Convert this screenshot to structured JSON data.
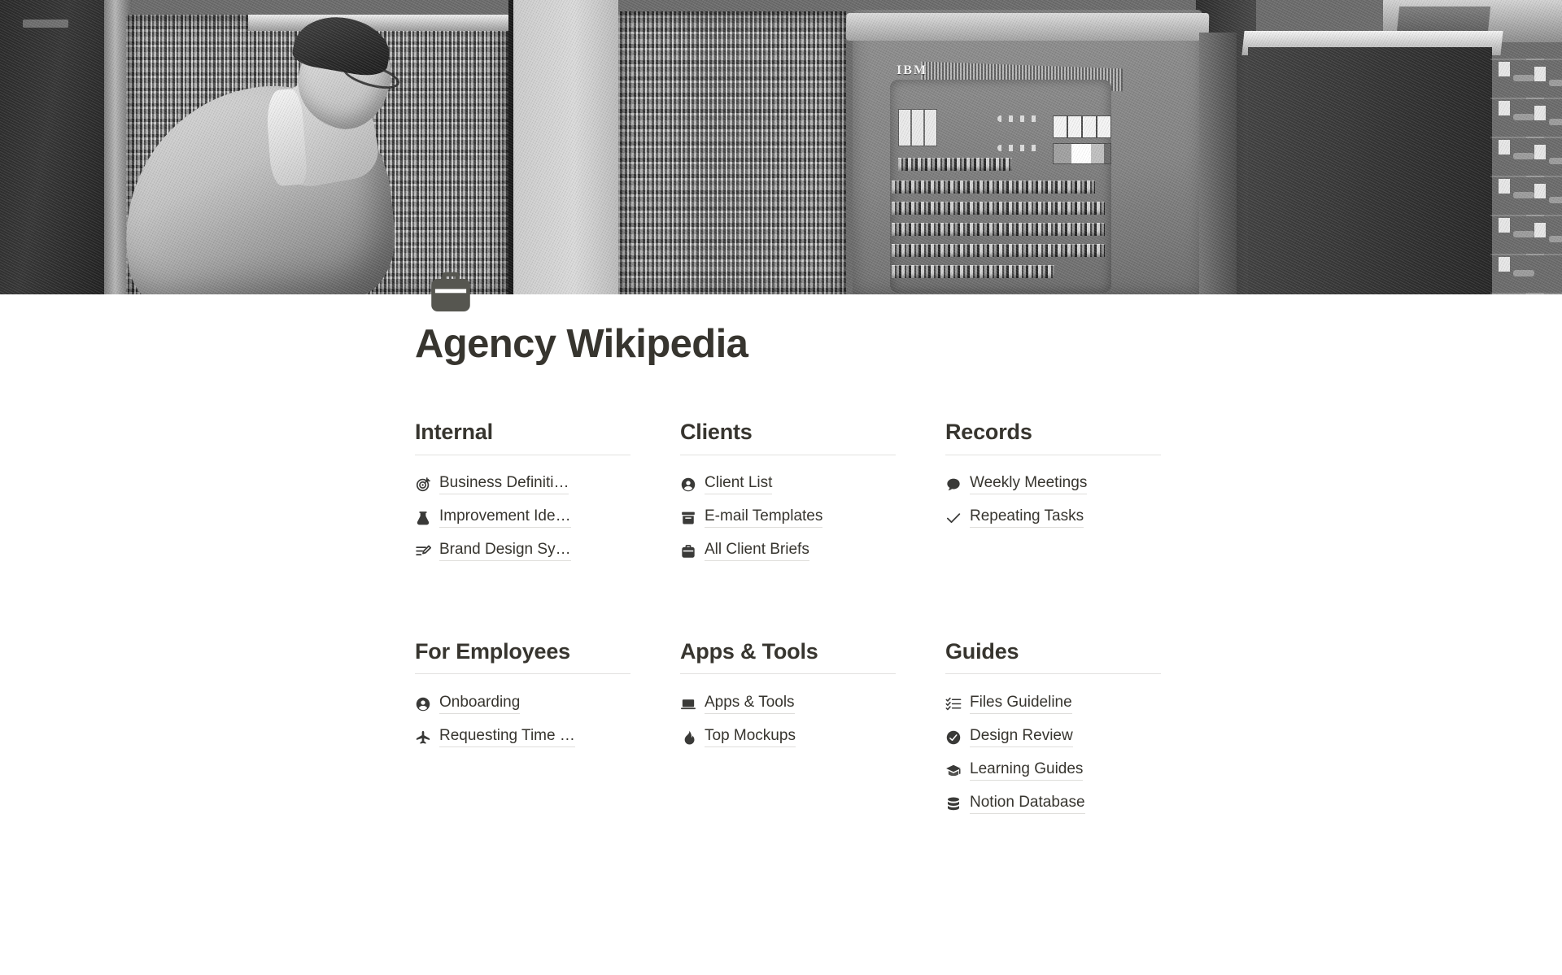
{
  "cover": {
    "alt": "Black and white photograph of a technician inspecting the wiring panel of a vintage IBM mainframe computer, with an IBM console and metal filing cabinets alongside",
    "brand_text": "IBM"
  },
  "page": {
    "icon": "briefcase-icon",
    "title": "Agency Wikipedia"
  },
  "colors": {
    "text": "#37352f",
    "icon": "#3a3a38",
    "rule": "#e3e2e0",
    "link_underline": "#dfdedb",
    "page_icon": "#565650"
  },
  "sections": [
    {
      "id": "internal",
      "title": "Internal",
      "links": [
        {
          "icon": "target-icon",
          "label": "Business Definiti…"
        },
        {
          "icon": "flask-icon",
          "label": "Improvement Ide…"
        },
        {
          "icon": "edit-list-icon",
          "label": "Brand Design Sy…"
        }
      ]
    },
    {
      "id": "clients",
      "title": "Clients",
      "links": [
        {
          "icon": "person-circle-icon",
          "label": "Client List"
        },
        {
          "icon": "archive-box-icon",
          "label": "E-mail Templates"
        },
        {
          "icon": "briefcase-icon",
          "label": "All Client Briefs"
        }
      ]
    },
    {
      "id": "records",
      "title": "Records",
      "links": [
        {
          "icon": "speech-bubble-icon",
          "label": "Weekly Meetings"
        },
        {
          "icon": "check-icon",
          "label": "Repeating Tasks"
        }
      ]
    },
    {
      "id": "for-employees",
      "title": "For Employees",
      "links": [
        {
          "icon": "person-circle-icon",
          "label": "Onboarding"
        },
        {
          "icon": "airplane-icon",
          "label": "Requesting Time …"
        }
      ]
    },
    {
      "id": "apps-tools",
      "title": "Apps & Tools",
      "links": [
        {
          "icon": "laptop-icon",
          "label": "Apps & Tools"
        },
        {
          "icon": "flame-icon",
          "label": "Top Mockups"
        }
      ]
    },
    {
      "id": "guides",
      "title": "Guides",
      "links": [
        {
          "icon": "checklist-icon",
          "label": "Files Guideline"
        },
        {
          "icon": "check-circle-icon",
          "label": "Design Review"
        },
        {
          "icon": "graduation-cap-icon",
          "label": "Learning Guides"
        },
        {
          "icon": "database-icon",
          "label": "Notion Database"
        }
      ]
    }
  ]
}
